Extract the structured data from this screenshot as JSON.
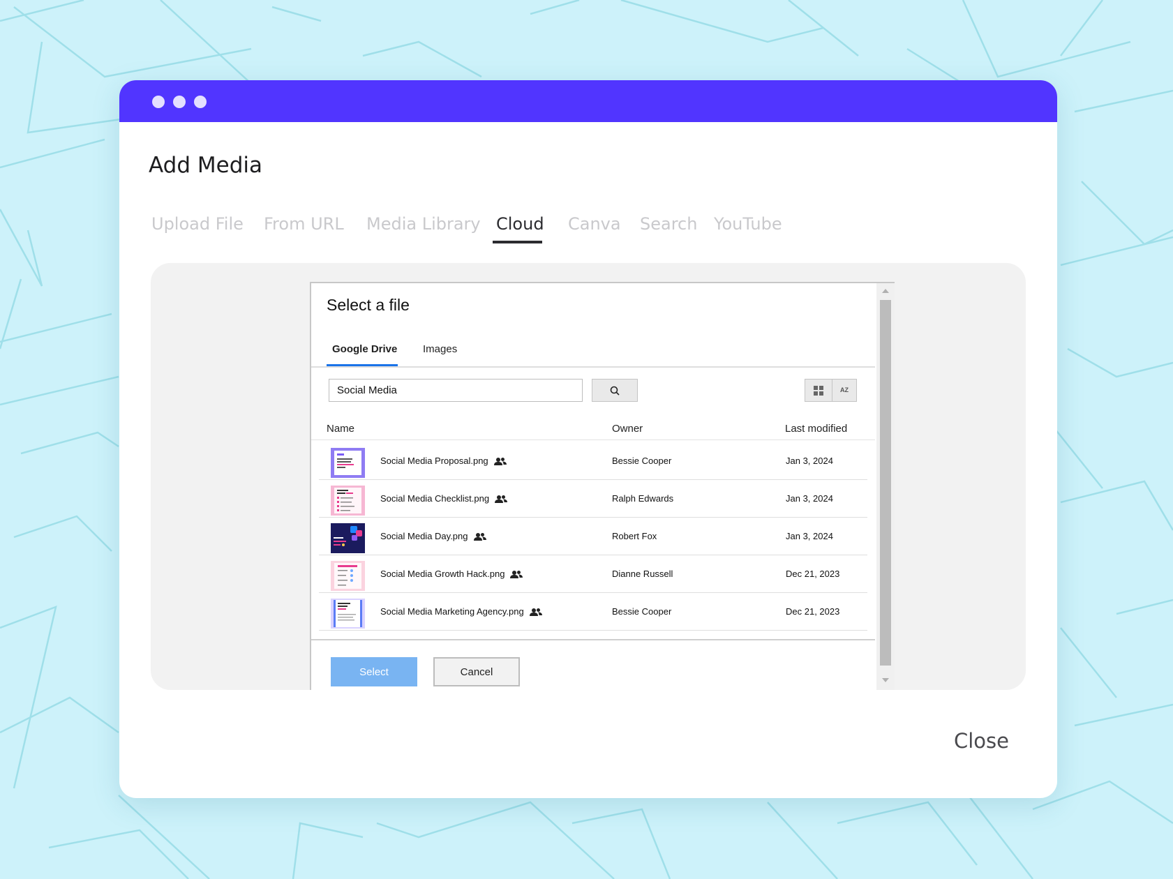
{
  "dialog": {
    "title": "Add Media",
    "close_label": "Close"
  },
  "media_tabs": [
    {
      "label": "Upload File",
      "active": false
    },
    {
      "label": "From URL",
      "active": false
    },
    {
      "label": "Media Library",
      "active": false
    },
    {
      "label": "Cloud",
      "active": true
    },
    {
      "label": "Canva",
      "active": false
    },
    {
      "label": "Search",
      "active": false
    },
    {
      "label": "YouTube",
      "active": false
    }
  ],
  "picker": {
    "title": "Select a file",
    "tabs": [
      {
        "label": "Google Drive",
        "active": true
      },
      {
        "label": "Images",
        "active": false
      }
    ],
    "search": {
      "value": "Social Media",
      "icon": "search-icon"
    },
    "view_icons": [
      "grid-view-icon",
      "sort-az-icon"
    ],
    "sort_label": "AZ",
    "columns": {
      "name": "Name",
      "owner": "Owner",
      "modified": "Last modified"
    },
    "files": [
      {
        "name": "Social Media Proposal.png",
        "owner": "Bessie Cooper",
        "modified": "Jan 3, 2024",
        "thumb_bg": "#8f7cf3",
        "thumb_text": "Win more clients with a strong Social Media"
      },
      {
        "name": "Social Media Checklist.png",
        "owner": "Ralph Edwards",
        "modified": "Jan 3, 2024",
        "thumb_bg": "#f6b7d3",
        "thumb_text": "Daily social media checklist"
      },
      {
        "name": "Social Media Day.png",
        "owner": "Robert Fox",
        "modified": "Jan 3, 2024",
        "thumb_bg": "#1b1b5e",
        "thumb_text": "Happy Social Media Day"
      },
      {
        "name": "Social Media Growth Hack.png",
        "owner": "Dianne Russell",
        "modified": "Dec 21, 2023",
        "thumb_bg": "#fbd3df",
        "thumb_text": ""
      },
      {
        "name": "Social Media Marketing Agency.png",
        "owner": "Bessie Cooper",
        "modified": "Dec 21, 2023",
        "thumb_bg": "#f7f4ff",
        "thumb_text": "Social Media Marketing Agency"
      }
    ],
    "select_label": "Select",
    "cancel_label": "Cancel"
  },
  "colors": {
    "titlebar": "#5135ff",
    "background": "#cdf2fa",
    "select_button": "#79b4f2",
    "active_tab_underline": "#1a73e8"
  }
}
